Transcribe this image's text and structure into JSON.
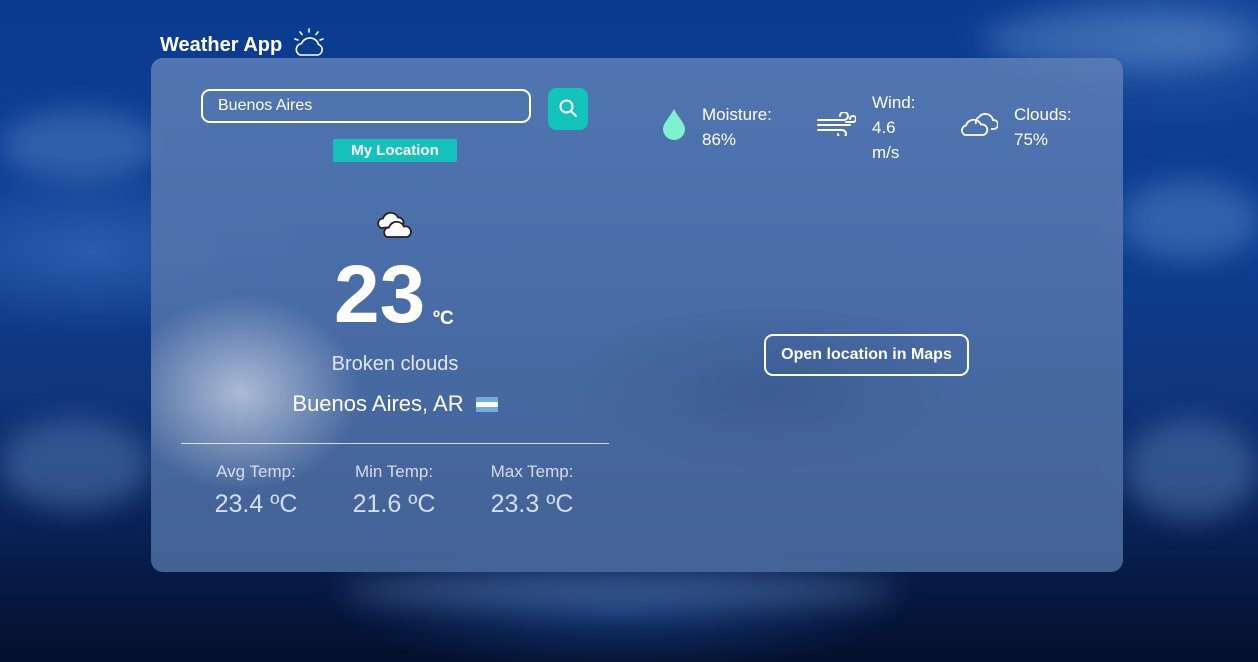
{
  "app": {
    "title": "Weather App"
  },
  "search": {
    "value": "Buenos Aires",
    "my_location_label": "My Location"
  },
  "current": {
    "icon": "broken-clouds-icon",
    "temperature": "23",
    "unit": "ºC",
    "description": "Broken clouds",
    "location": "Buenos Aires, AR",
    "flag": "argentina-flag"
  },
  "stats": [
    {
      "label": "Avg Temp:",
      "value": "23.4 ºC"
    },
    {
      "label": "Min Temp:",
      "value": "21.6 ºC"
    },
    {
      "label": "Max Temp:",
      "value": "23.3 ºC"
    }
  ],
  "metrics": {
    "moisture": {
      "label": "Moisture:",
      "value": "86%"
    },
    "wind": {
      "label": "Wind:",
      "value": "4.6",
      "unit": "m/s"
    },
    "clouds": {
      "label": "Clouds:",
      "value": "75%"
    }
  },
  "maps_button": "Open location in Maps",
  "colors": {
    "accent": "#12c2bb",
    "drop": "#7ff0d0"
  }
}
